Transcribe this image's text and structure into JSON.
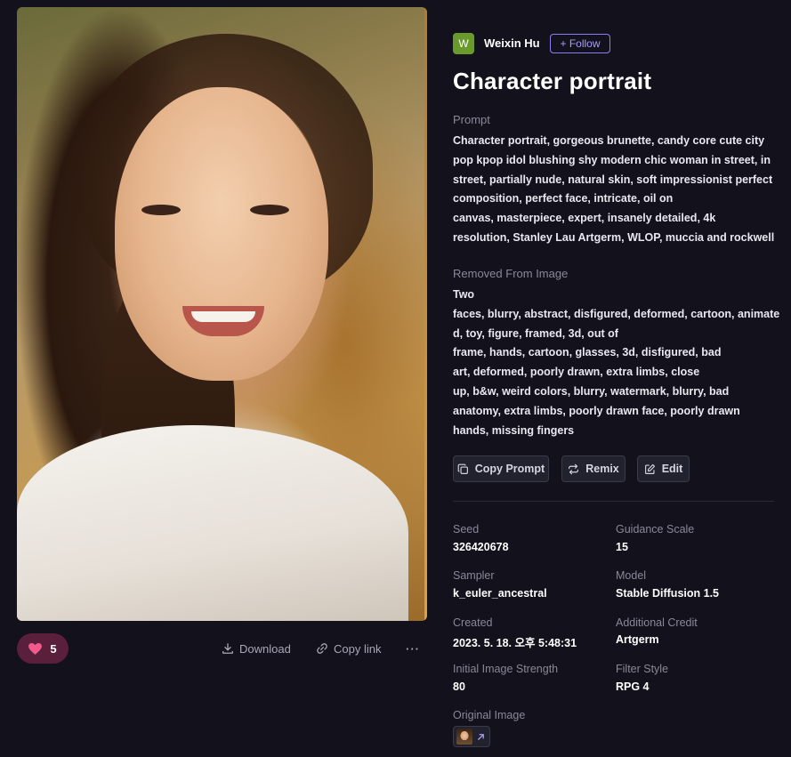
{
  "author": {
    "avatar_letter": "W",
    "name": "Weixin Hu",
    "follow_label": "+ Follow"
  },
  "title": "Character portrait",
  "prompt": {
    "label": "Prompt",
    "lines": [
      "Character portrait, gorgeous brunette, candy core cute city",
      "pop kpop idol blushing shy modern chic woman in street, in",
      "street, partially nude, natural skin, soft impressionist perfect",
      "composition, perfect face, intricate, oil on",
      "canvas, masterpiece, expert, insanely detailed, 4k",
      "resolution, Stanley Lau Artgerm, WLOP, muccia and rockwell"
    ]
  },
  "negative": {
    "label": "Removed From Image",
    "lines": [
      "Two",
      "faces, blurry, abstract, disfigured, deformed, cartoon, animate",
      "d, toy, figure, framed, 3d, out of",
      "frame, hands, cartoon, glasses, 3d, disfigured, bad",
      "art, deformed, poorly drawn, extra limbs, close",
      "up, b&w, weird colors, blurry, watermark, blurry, bad",
      "anatomy, extra limbs, poorly drawn face, poorly drawn",
      "hands, missing fingers"
    ]
  },
  "actions": {
    "copy_prompt": "Copy Prompt",
    "remix": "Remix",
    "edit": "Edit"
  },
  "meta": {
    "seed_label": "Seed",
    "seed": "326420678",
    "guidance_label": "Guidance Scale",
    "guidance": "15",
    "sampler_label": "Sampler",
    "sampler": "k_euler_ancestral",
    "model_label": "Model",
    "model": "Stable Diffusion 1.5",
    "created_label": "Created",
    "created": "2023. 5. 18. 오후 5:48:31",
    "credit_label": "Additional Credit",
    "credit": "Artgerm",
    "strength_label": "Initial Image Strength",
    "strength": "80",
    "filter_label": "Filter Style",
    "filter": "RPG 4",
    "original_label": "Original Image"
  },
  "bottom_bar": {
    "likes": "5",
    "download": "Download",
    "copy_link": "Copy link",
    "more": "···"
  },
  "colors": {
    "background": "#12111c",
    "accent": "#8b7cf7",
    "like_bg": "#5a1f3a",
    "heart": "#f25a8c"
  }
}
